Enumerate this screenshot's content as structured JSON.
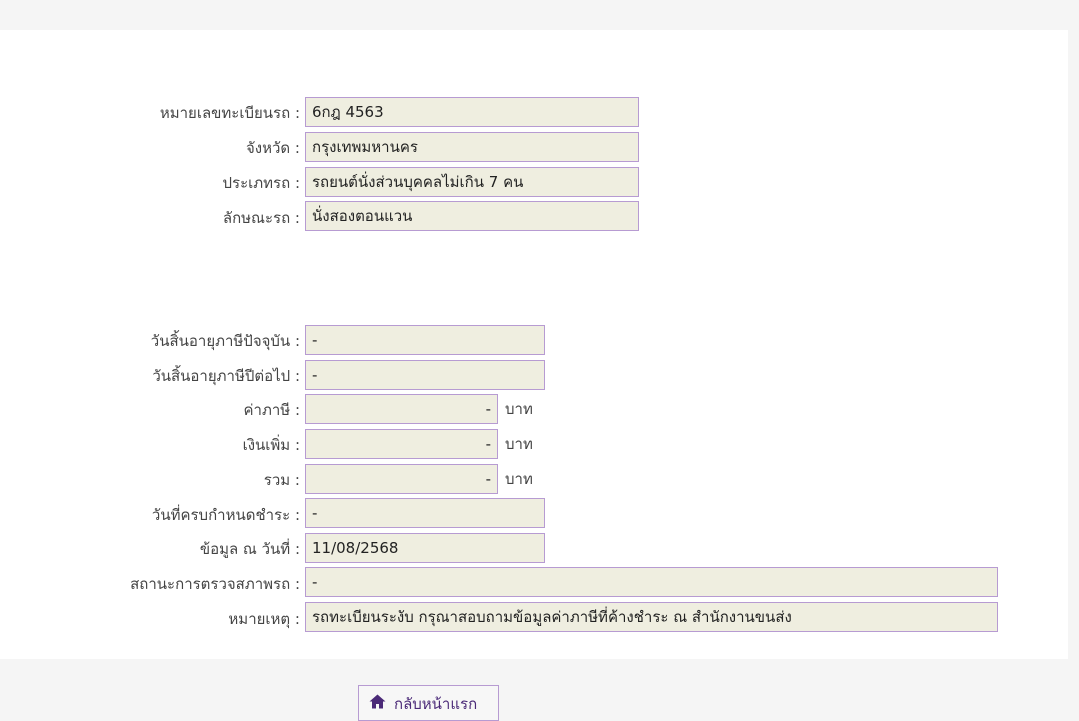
{
  "vehicle": {
    "plate_label": "หมายเลขทะเบียนรถ :",
    "plate_value": "6กฎ 4563",
    "province_label": "จังหวัด :",
    "province_value": "กรุงเทพมหานคร",
    "type_label": "ประเภทรถ :",
    "type_value": "รถยนต์นั่งส่วนบุคคลไม่เกิน 7 คน",
    "body_label": "ลักษณะรถ :",
    "body_value": "นั่งสองตอนแวน"
  },
  "tax": {
    "expire_current_label": "วันสิ้นอายุภาษีปัจจุบัน :",
    "expire_current_value": "-",
    "expire_next_label": "วันสิ้นอายุภาษีปีต่อไป :",
    "expire_next_value": "-",
    "tax_label": "ค่าภาษี :",
    "tax_value": "-",
    "extra_label": "เงินเพิ่ม :",
    "extra_value": "-",
    "total_label": "รวม :",
    "total_value": "-",
    "unit": "บาท",
    "due_label": "วันที่ครบกำหนดชำระ :",
    "due_value": "-",
    "asof_label": "ข้อมูล ณ วันที่ :",
    "asof_value": "11/08/2568",
    "inspection_label": "สถานะการตรวจสภาพรถ :",
    "inspection_value": "-",
    "note_label": "หมายเหตุ :",
    "note_value": "รถทะเบียนระงับ กรุณาสอบถามข้อมูลค่าภาษีที่ค้างชำระ ณ สำนักงานขนส่ง"
  },
  "actions": {
    "home_label": "กลับหน้าแรก",
    "home_icon": "home-icon"
  },
  "colors": {
    "field_bg": "#efeee0",
    "field_border": "#b79bd2",
    "accent": "#4b2a78"
  }
}
